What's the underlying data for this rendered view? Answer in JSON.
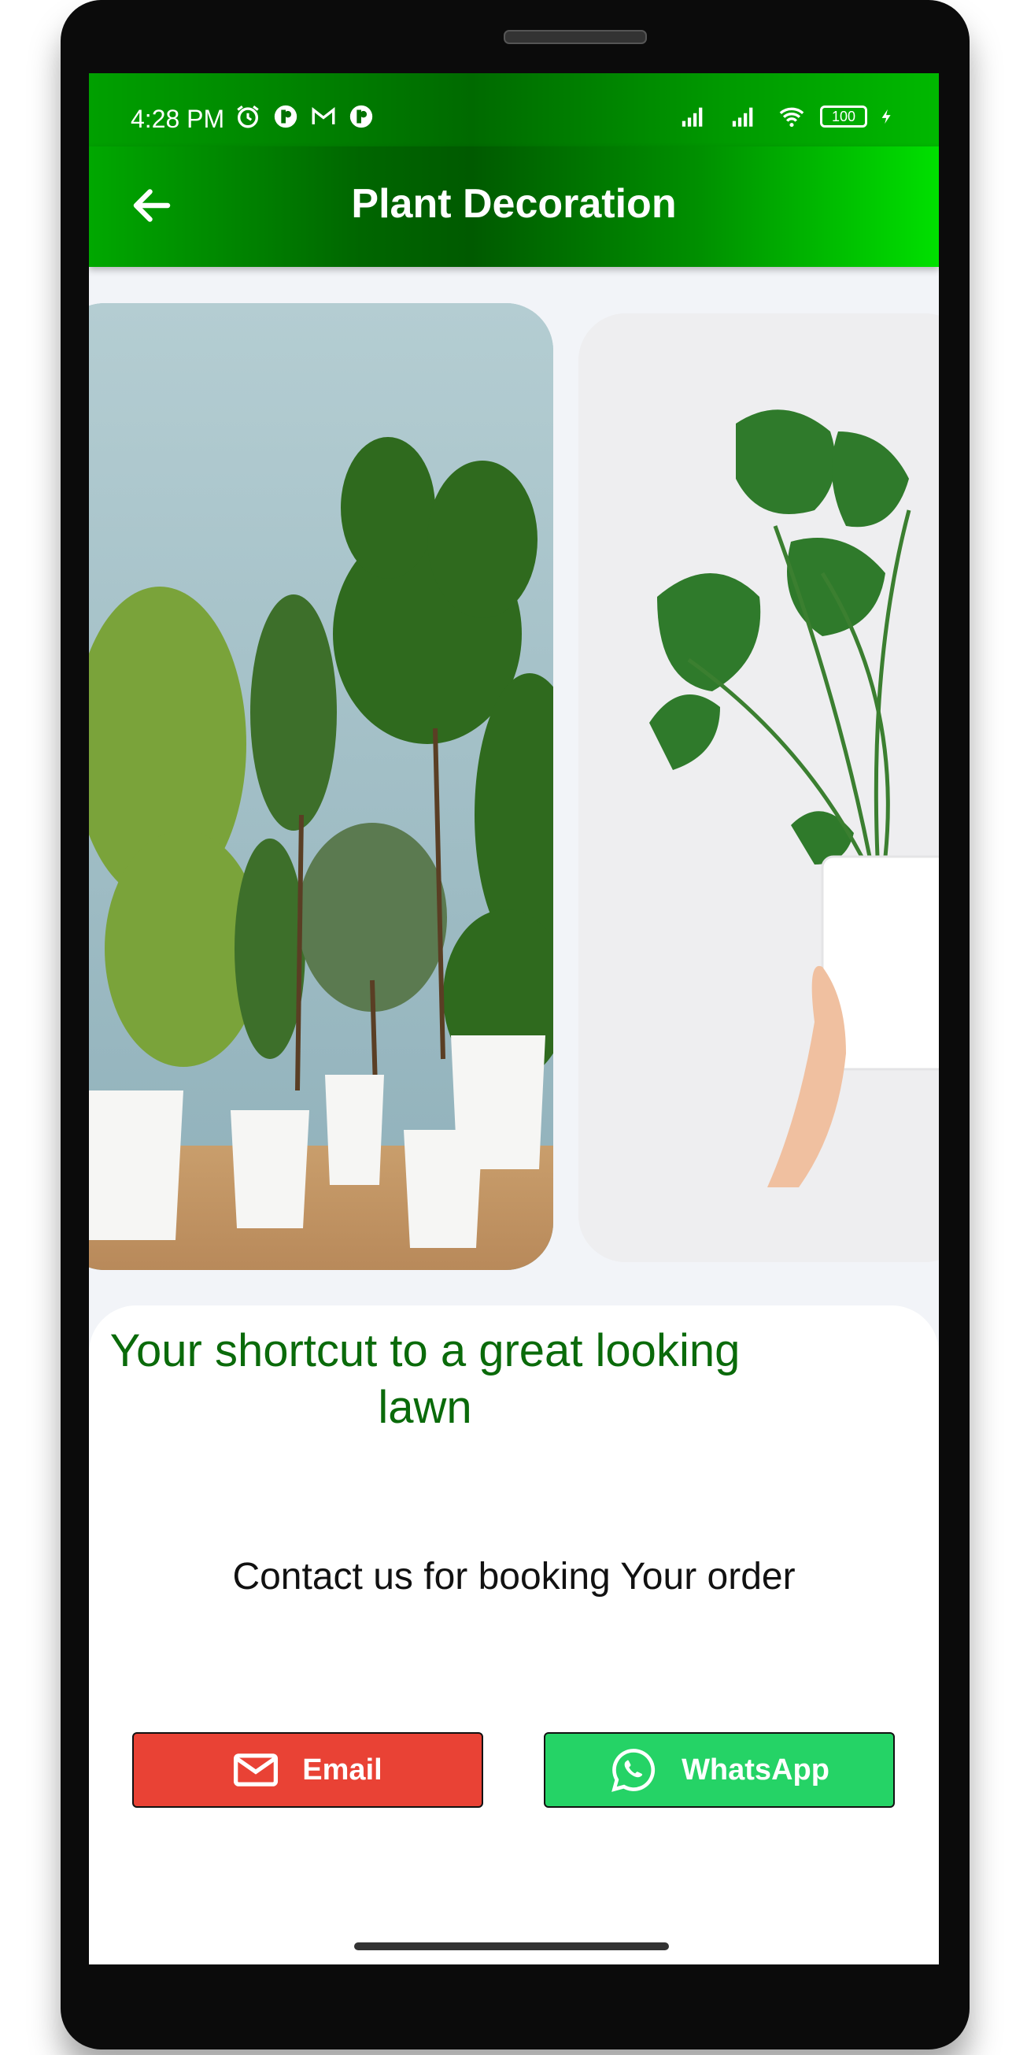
{
  "status_bar": {
    "time": "4:28 PM",
    "battery": "100",
    "icons_left": [
      "alarm-icon",
      "app-icon",
      "gmail-icon",
      "app-icon"
    ],
    "icons_right": [
      "signal-icon",
      "signal-icon",
      "wifi-icon",
      "battery-icon",
      "charging-icon"
    ]
  },
  "app_bar": {
    "title": "Plant Decoration",
    "back_icon": "arrow-left-icon",
    "colors": {
      "dark": "#006600",
      "light": "#00e000"
    }
  },
  "carousel": {
    "items": [
      {
        "image": "potted-plants-row"
      },
      {
        "image": "monstera-in-hand"
      }
    ]
  },
  "content": {
    "headline": "Your shortcut to a great looking lawn",
    "subtitle": "Contact us for booking Your order",
    "headline_color": "#0a6a0a"
  },
  "buttons": {
    "email": {
      "label": "Email",
      "icon": "mail-icon",
      "color": "#e94235"
    },
    "whatsapp": {
      "label": "WhatsApp",
      "icon": "whatsapp-icon",
      "color": "#25d366"
    }
  }
}
